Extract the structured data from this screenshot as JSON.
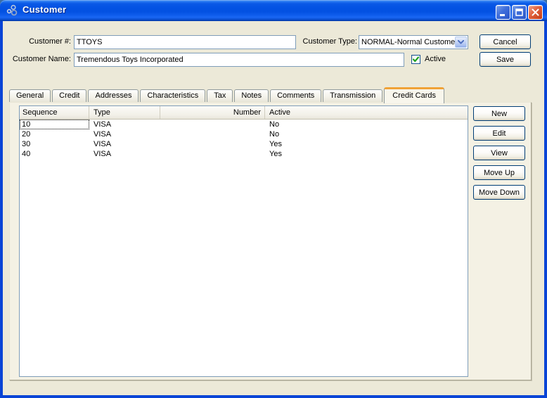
{
  "window": {
    "title": "Customer"
  },
  "form": {
    "customer_number": {
      "label": "Customer #:",
      "value": "TTOYS"
    },
    "customer_type": {
      "label": "Customer Type:",
      "value": "NORMAL-Normal Customers"
    },
    "customer_name": {
      "label": "Customer Name:",
      "value": "Tremendous Toys Incorporated"
    },
    "active": {
      "label": "Active",
      "checked": true
    },
    "cancel_label": "Cancel",
    "save_label": "Save"
  },
  "tabs": [
    {
      "label": "General",
      "active": false
    },
    {
      "label": "Credit",
      "active": false
    },
    {
      "label": "Addresses",
      "active": false
    },
    {
      "label": "Characteristics",
      "active": false
    },
    {
      "label": "Tax",
      "active": false
    },
    {
      "label": "Notes",
      "active": false
    },
    {
      "label": "Comments",
      "active": false
    },
    {
      "label": "Transmission",
      "active": false
    },
    {
      "label": "Credit Cards",
      "active": true
    }
  ],
  "table": {
    "columns": [
      "Sequence",
      "Type",
      "Number",
      "Active"
    ],
    "rows": [
      {
        "sequence": "10",
        "type": "VISA",
        "number": "",
        "active": "No"
      },
      {
        "sequence": "20",
        "type": "VISA",
        "number": "",
        "active": "No"
      },
      {
        "sequence": "30",
        "type": "VISA",
        "number": "",
        "active": "Yes"
      },
      {
        "sequence": "40",
        "type": "VISA",
        "number": "",
        "active": "Yes"
      }
    ]
  },
  "actions": [
    "New",
    "Edit",
    "View",
    "Move Up",
    "Move Down"
  ],
  "colors": {
    "titlebar_blue": "#0352E3",
    "window_border": "#0A44D6",
    "background": "#ECE9D8",
    "panel_background": "#F4F1E4",
    "active_tab_accent": "#F0A236",
    "table_border": "#7F9DB9",
    "check_green": "#21A121",
    "close_button_red": "#E0603C",
    "button_border": "#003C74"
  }
}
